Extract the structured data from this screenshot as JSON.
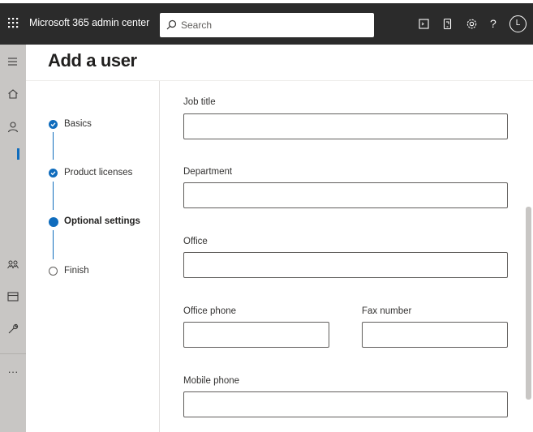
{
  "header": {
    "app_title": "Microsoft 365 admin center",
    "search_placeholder": "Search",
    "avatar_initial": "L",
    "icons": [
      "app-launcher-icon",
      "terminal-icon",
      "mobile-app-icon",
      "settings-icon",
      "help-icon"
    ],
    "background_color": "#2b2b2b"
  },
  "left_nav": {
    "icons": [
      "hamburger-menu-icon",
      "home-icon",
      "users-icon",
      "teams-groups-icon",
      "billing-icon",
      "setup-wrench-icon",
      "more-ellipsis-icon"
    ],
    "background_color": "#c8c6c4",
    "active_indicator_color": "#0f6cbd"
  },
  "page": {
    "title": "Add a user"
  },
  "wizard": {
    "steps": [
      {
        "label": "Basics",
        "state": "completed"
      },
      {
        "label": "Product licenses",
        "state": "completed"
      },
      {
        "label": "Optional settings",
        "state": "current"
      },
      {
        "label": "Finish",
        "state": "pending"
      }
    ],
    "accent_color": "#0f6cbd"
  },
  "form": {
    "job_title_label": "Job title",
    "job_title_value": "",
    "department_label": "Department",
    "department_value": "",
    "office_label": "Office",
    "office_value": "",
    "office_phone_label": "Office phone",
    "office_phone_value": "",
    "fax_number_label": "Fax number",
    "fax_number_value": "",
    "mobile_phone_label": "Mobile phone",
    "mobile_phone_value": ""
  }
}
